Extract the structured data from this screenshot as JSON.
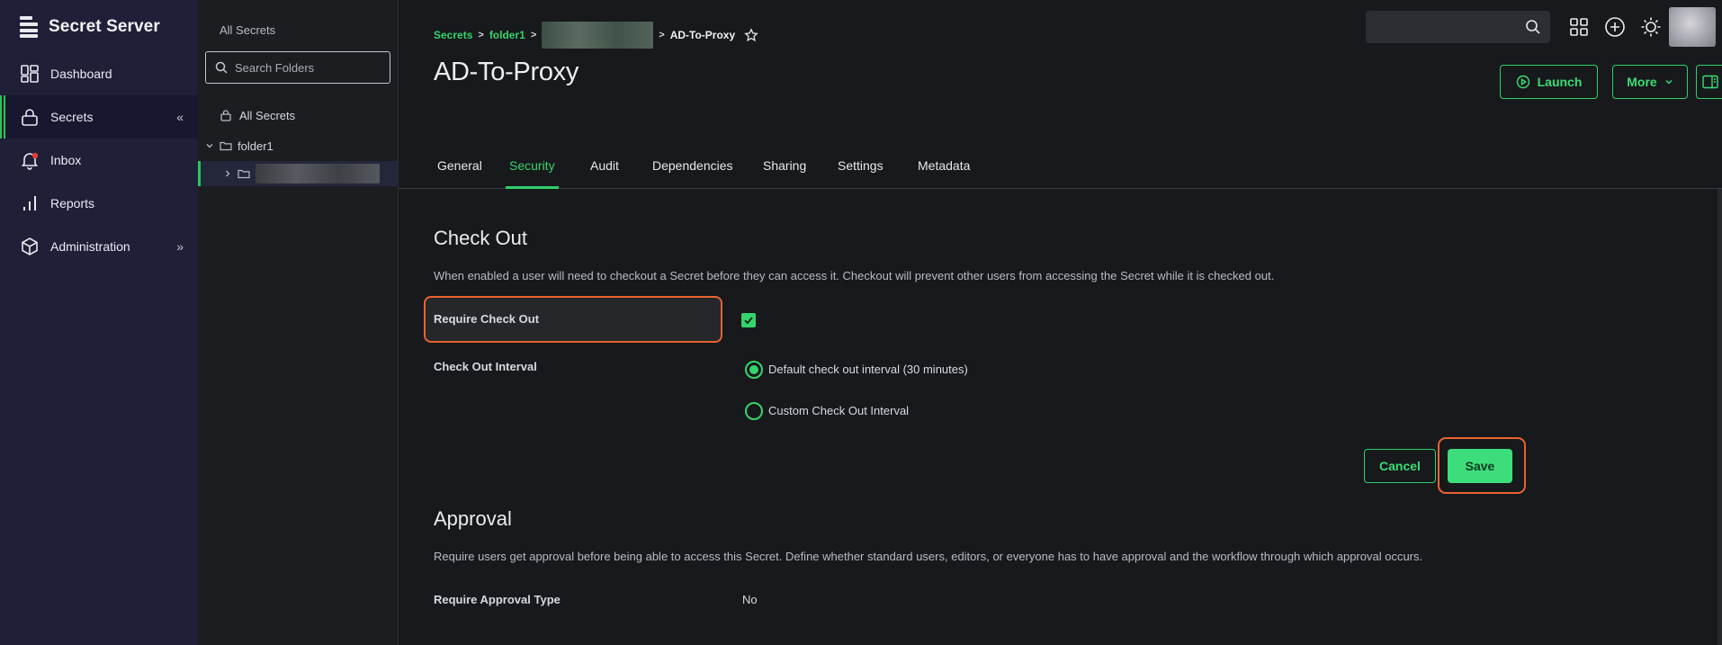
{
  "app": {
    "brand": "Secret Server"
  },
  "nav": {
    "items": [
      {
        "label": "Dashboard",
        "icon": "dashboard-icon"
      },
      {
        "label": "Secrets",
        "icon": "lock-icon",
        "active": true,
        "chevron": "«"
      },
      {
        "label": "Inbox",
        "icon": "bell-icon",
        "badge_color": "#e53935"
      },
      {
        "label": "Reports",
        "icon": "bar-chart-icon"
      },
      {
        "label": "Administration",
        "icon": "cube-icon",
        "chevron": "»"
      }
    ]
  },
  "folders": {
    "title": "All Secrets",
    "search_placeholder": "Search Folders",
    "tree": [
      {
        "label": "All Secrets",
        "icon": "lock-icon"
      },
      {
        "label": "folder1",
        "icon": "folder-icon",
        "expanded": true
      },
      {
        "label": "",
        "icon": "folder-icon",
        "redacted": true,
        "selected": true
      }
    ]
  },
  "header": {
    "breadcrumb": {
      "root": "Secrets",
      "folder": "folder1",
      "current": "AD-To-Proxy"
    },
    "title": "AD-To-Proxy",
    "launch_label": "Launch",
    "more_label": "More"
  },
  "tabs": [
    "General",
    "Security",
    "Audit",
    "Dependencies",
    "Sharing",
    "Settings",
    "Metadata"
  ],
  "active_tab": "Security",
  "checkout": {
    "title": "Check Out",
    "description": "When enabled a user will need to checkout a Secret before they can access it. Checkout will prevent other users from accessing the Secret while it is checked out.",
    "require_label": "Require Check Out",
    "require_checked": true,
    "interval_label": "Check Out Interval",
    "options": [
      {
        "label": "Default check out interval (30 minutes)",
        "checked": true
      },
      {
        "label": "Custom Check Out Interval",
        "checked": false
      }
    ],
    "cancel_label": "Cancel",
    "save_label": "Save"
  },
  "approval": {
    "title": "Approval",
    "description": "Require users get approval before being able to access this Secret. Define whether standard users, editors, or everyone has to have approval and the workflow through which approval occurs.",
    "type_label": "Require Approval Type",
    "type_value": "No"
  },
  "colors": {
    "accent": "#2fcf68",
    "highlight": "#e8632e",
    "nav_bg": "#1f1f38",
    "main_bg": "#17191c"
  }
}
